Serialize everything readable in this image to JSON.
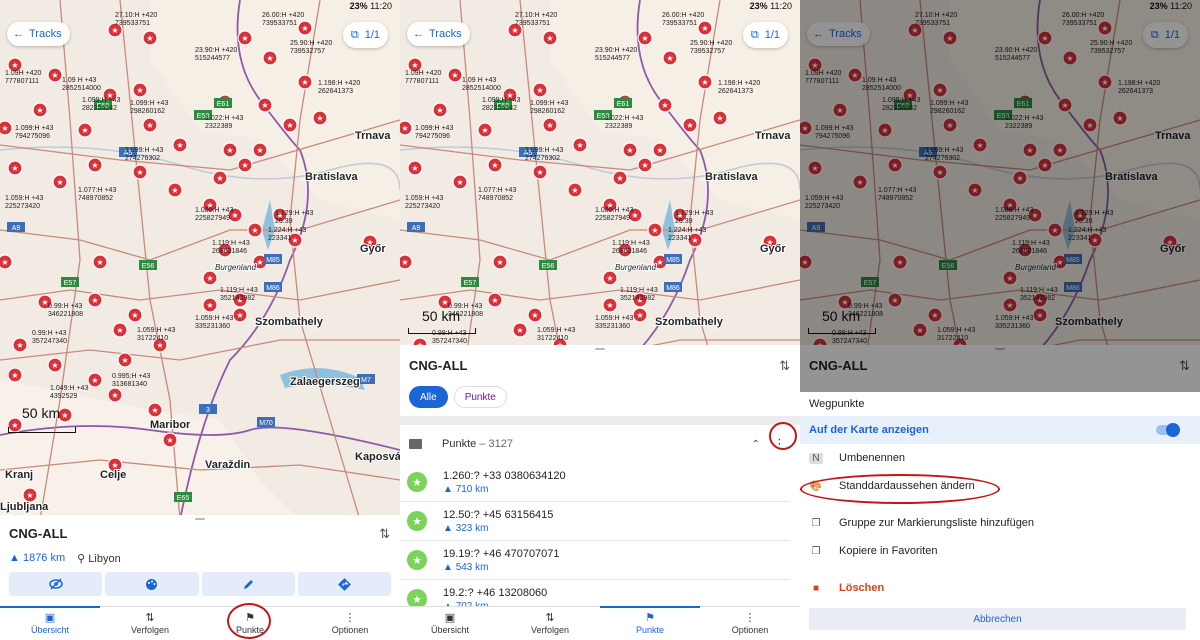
{
  "status": {
    "battery": "23%",
    "time": "11:20"
  },
  "map": {
    "tracks_label": "Tracks",
    "page_indicator": "1/1",
    "scale_label": "50 km",
    "cities": [
      "Trnava",
      "Bratislava",
      "Győr",
      "Szombathely",
      "Zalaegerszeg",
      "Maribor",
      "Varaždin",
      "Kaposvár",
      "Ljubljana",
      "Celje",
      "Burgenland",
      "Kranj"
    ],
    "roads": [
      "E59",
      "E58",
      "E57",
      "E56",
      "M86",
      "M85",
      "M70",
      "M7",
      "A9",
      "A5",
      "E61",
      "E65",
      "3"
    ],
    "point_labels": [
      "27.10:H +420 739533751",
      "26.00:H +420 739533751",
      "25.90:H +420 739532757",
      "23.90:H +420 515244577",
      "1.09H +420 777807111",
      "1.09 H +43 2852514000",
      "1.099:H +43 282254242",
      "1.099:H +43 298260162",
      "1.022:H +43 2322389",
      "1.198:H +420 262641373",
      "1.099:H +43 274276302",
      "1.077:H +43 748970852",
      "1.059:H +43 225273420",
      "1.089:H +43 225827949",
      "1.129:H +43 26.39",
      "1.224:H +43 223341",
      "1.119:H +43 266621846",
      "1.119:H +43 352142982",
      "1.059:H +43 335231360",
      "0.99:H +43 357247340",
      "0.99:H +43 346221808",
      "1.059:H +43 31722410",
      "0.995:H +43 313681340",
      "1.049:H +43 4352529",
      "1.099:H +43 794275096"
    ]
  },
  "panel1": {
    "title": "CNG-ALL",
    "distance": "1876 km",
    "location": "Libyon",
    "action_icons": [
      "eye-off-icon",
      "palette-icon",
      "edit-icon",
      "directions-icon"
    ]
  },
  "panel2": {
    "title": "CNG-ALL",
    "chips": [
      "Alle",
      "Punkte"
    ],
    "group_name": "Punkte",
    "group_count": "– 3127",
    "waypoints": [
      {
        "name": "1.260:? +33 0380634120",
        "dist": "710 km"
      },
      {
        "name": "12.50:? +45 63156415",
        "dist": "323 km"
      },
      {
        "name": "19.19:? +46 470707071",
        "dist": "543 km"
      },
      {
        "name": "19.2:? +46 13208060",
        "dist": "702 km"
      }
    ]
  },
  "panel3": {
    "title": "CNG-ALL",
    "menu_title": "Wegpunkte",
    "items": {
      "show_on_map": "Auf der Karte anzeigen",
      "rename": "Umbenennen",
      "change_appearance": "Standdardaussehen ändern",
      "add_to_markers": "Gruppe zur Markierungsliste hinzufügen",
      "copy_favorites": "Kopiere in Favoriten",
      "delete": "Löschen",
      "cancel": "Abbrechen"
    }
  },
  "nav": [
    "Übersicht",
    "Verfolgen",
    "Punkte",
    "Optionen"
  ],
  "colors": {
    "accent": "#1a66d2",
    "marker": "#d9303a",
    "highlight": "#c01818",
    "star": "#7bd35b"
  }
}
